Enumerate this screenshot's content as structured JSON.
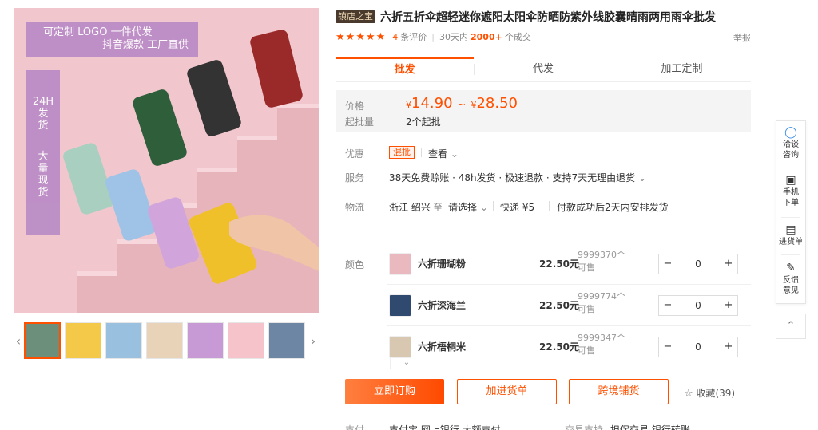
{
  "gallery": {
    "promo_line1": "可定制 LOGO  一件代发",
    "promo_line2": "抖音爆款  工厂直供",
    "promo_side_top": [
      "24H",
      "发",
      "货"
    ],
    "promo_side_bottom": [
      "大",
      "量",
      "现",
      "货"
    ],
    "umbrella_colors": [
      "#a9cfc0",
      "#2f5e3a",
      "#333333",
      "#9a2a2a",
      "#9ec3e6",
      "#d1a5db",
      "#f0c02b"
    ],
    "thumb_colors": [
      "#6b8f7a",
      "#f4c94a",
      "#9ac0e0",
      "#e8d2b8",
      "#c79ad6",
      "#f5c3c9",
      "#6c86a3"
    ],
    "prev_icon": "chevron-left-icon",
    "next_icon": "chevron-right-icon"
  },
  "product": {
    "shop_tag": "镇店之宝",
    "title": "六折五折伞超轻迷你遮阳太阳伞防晒防紫外线胶囊晴雨两用雨伞批发",
    "stars": 5,
    "review_count": "4",
    "review_label": "条评价",
    "sold_prefix": "30天内",
    "sold_count": "2000+",
    "sold_suffix": "个成交",
    "report_label": "举报"
  },
  "tabs": [
    {
      "label": "批发",
      "active": true
    },
    {
      "label": "代发",
      "active": false
    },
    {
      "label": "加工定制",
      "active": false
    }
  ],
  "price": {
    "label": "价格",
    "currency": "¥",
    "min": "14.90",
    "range_sep": "~",
    "max": "28.50",
    "moq_label": "起批量",
    "moq_value": "2个起批"
  },
  "info": {
    "promo_label": "优惠",
    "promo_badge": "混批",
    "promo_link": "查看",
    "service_label": "服务",
    "service_text": "38天免费赊账 · 48h发货 · 极速退款 · 支持7天无理由退货",
    "logistics_label": "物流",
    "origin": "浙江 绍兴",
    "to": "至",
    "dest_placeholder": "请选择",
    "shipping": "快递  ¥5",
    "dispatch": "付款成功后2天内安排发货"
  },
  "sku": {
    "label": "颜色",
    "items": [
      {
        "name": "六折珊瑚粉",
        "price": "22.50元",
        "stock": "9999370个可售",
        "qty": "0",
        "color": "#e9b9bf"
      },
      {
        "name": "六折深海兰",
        "price": "22.50元",
        "stock": "9999774个可售",
        "qty": "0",
        "color": "#2f4a6e"
      },
      {
        "name": "六折梧桐米",
        "price": "22.50元",
        "stock": "9999347个可售",
        "qty": "0",
        "color": "#d8c8b2"
      }
    ],
    "minus": "−",
    "plus": "+"
  },
  "actions": {
    "buy": "立即订购",
    "cart": "加进货单",
    "crossborder": "跨境铺货",
    "favorite": "收藏(39)"
  },
  "payment": {
    "label": "支付",
    "methods": "支付宝   网上银行   大额支付",
    "trade_label": "交易支持",
    "trade_methods": "担保交易   银行转账"
  },
  "float_bar": {
    "chat": "洽谈咨询",
    "mobile": "手机下单",
    "cart": "进货单",
    "feedback": "反馈意见"
  }
}
